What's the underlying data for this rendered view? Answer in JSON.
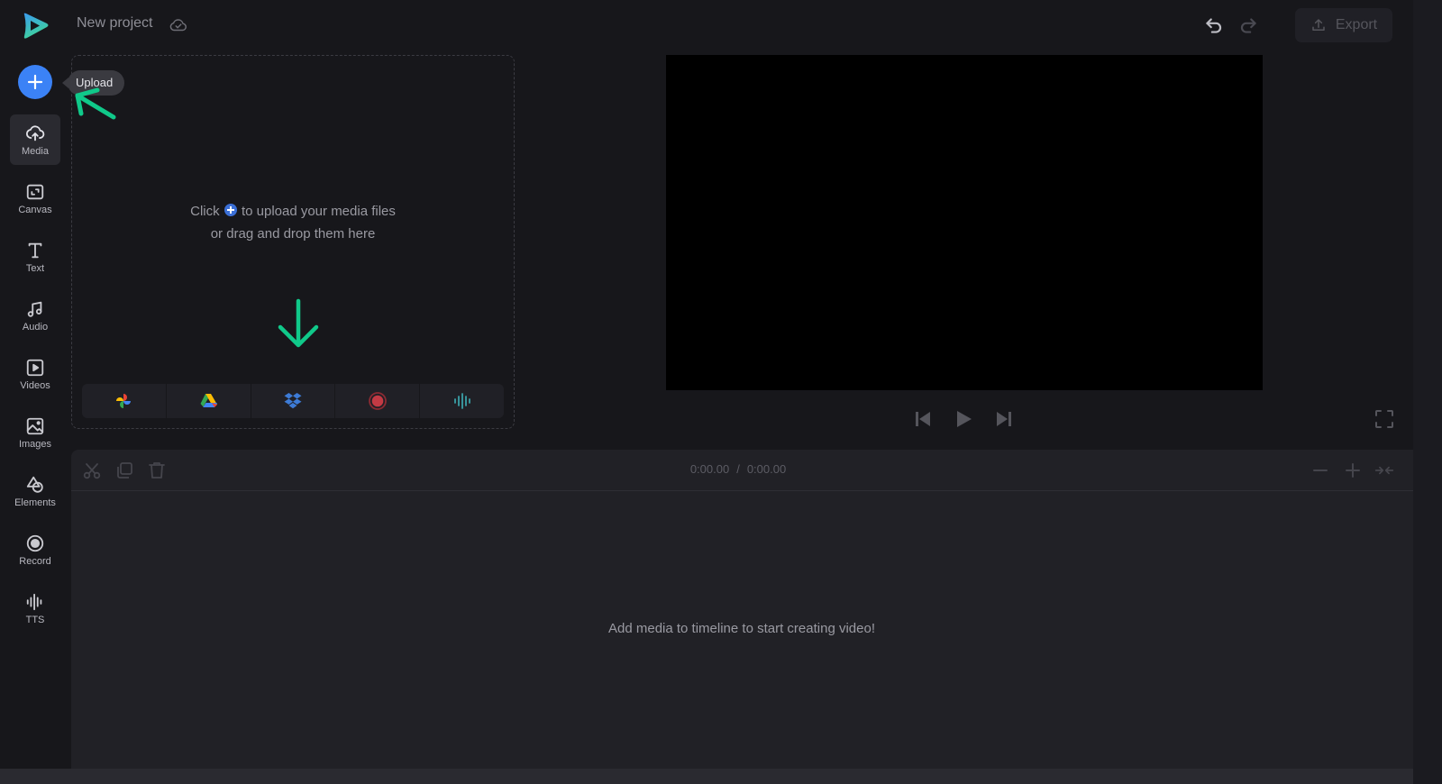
{
  "header": {
    "logo": "app-logo",
    "project_title": "New project",
    "save_status_icon": "cloud-check-icon",
    "undo_icon": "undo-icon",
    "redo_icon": "redo-icon",
    "export_label": "Export",
    "export_icon": "upload-icon"
  },
  "sidebar": {
    "upload_button_icon": "plus-icon",
    "upload_tooltip": "Upload",
    "items": [
      {
        "label": "Media",
        "icon": "cloud-upload-icon",
        "active": true
      },
      {
        "label": "Canvas",
        "icon": "canvas-resize-icon",
        "active": false
      },
      {
        "label": "Text",
        "icon": "text-icon",
        "active": false
      },
      {
        "label": "Audio",
        "icon": "music-note-icon",
        "active": false
      },
      {
        "label": "Videos",
        "icon": "video-play-icon",
        "active": false
      },
      {
        "label": "Images",
        "icon": "image-icon",
        "active": false
      },
      {
        "label": "Elements",
        "icon": "shapes-icon",
        "active": false
      },
      {
        "label": "Record",
        "icon": "record-icon",
        "active": false
      },
      {
        "label": "TTS",
        "icon": "waveform-icon",
        "active": false
      }
    ]
  },
  "media_panel": {
    "hint_line1_before": "Click",
    "hint_line1_after": "to upload your media files",
    "hint_line2": "or drag and drop them here",
    "sources": [
      {
        "name": "google-photos",
        "icon": "google-photos-icon"
      },
      {
        "name": "google-drive",
        "icon": "google-drive-icon"
      },
      {
        "name": "dropbox",
        "icon": "dropbox-icon"
      },
      {
        "name": "record",
        "icon": "record-icon"
      },
      {
        "name": "tts",
        "icon": "waveform-icon"
      }
    ]
  },
  "annotations": {
    "color": "#10c98a",
    "arrows": [
      "arrow-to-upload-button",
      "arrow-down-to-sources"
    ]
  },
  "player": {
    "prev_icon": "skip-back-icon",
    "play_icon": "play-icon",
    "next_icon": "skip-forward-icon",
    "fullscreen_icon": "fullscreen-icon"
  },
  "timeline": {
    "tools": [
      "scissors-icon",
      "duplicate-icon",
      "trash-icon"
    ],
    "current_time": "0:00.00",
    "separator": "/",
    "total_time": "0:00.00",
    "zoom_out_icon": "minus-icon",
    "zoom_in_icon": "plus-icon",
    "fit_icon": "collapse-icon",
    "empty_message": "Add media to timeline to start creating video!"
  },
  "colors": {
    "accent": "#3b82f6",
    "background": "#17171b",
    "timeline_bg": "#212126",
    "annotation": "#10c98a"
  }
}
